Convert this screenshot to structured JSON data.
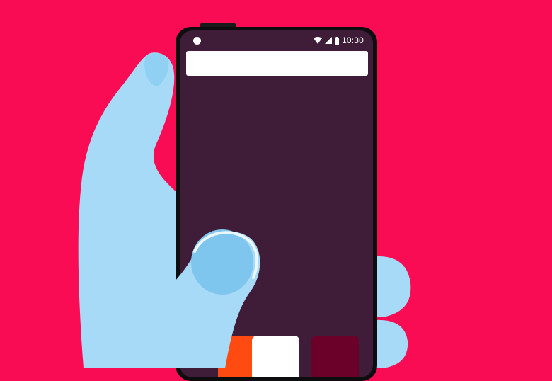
{
  "status_bar": {
    "time": "10:30",
    "icons": [
      "wifi-icon",
      "cellular-signal-icon",
      "battery-icon"
    ]
  },
  "colors": {
    "background": "#FA0C55",
    "phone_frame": "#0d0d0f",
    "screen": "#3F1C37",
    "search_bar": "#ffffff",
    "hand": "#A6DAF6",
    "hand_shadow": "#7FC6EE",
    "tile_orange": "#FF4A12",
    "tile_white": "#ffffff",
    "tile_aubergine": "#6B0028"
  }
}
